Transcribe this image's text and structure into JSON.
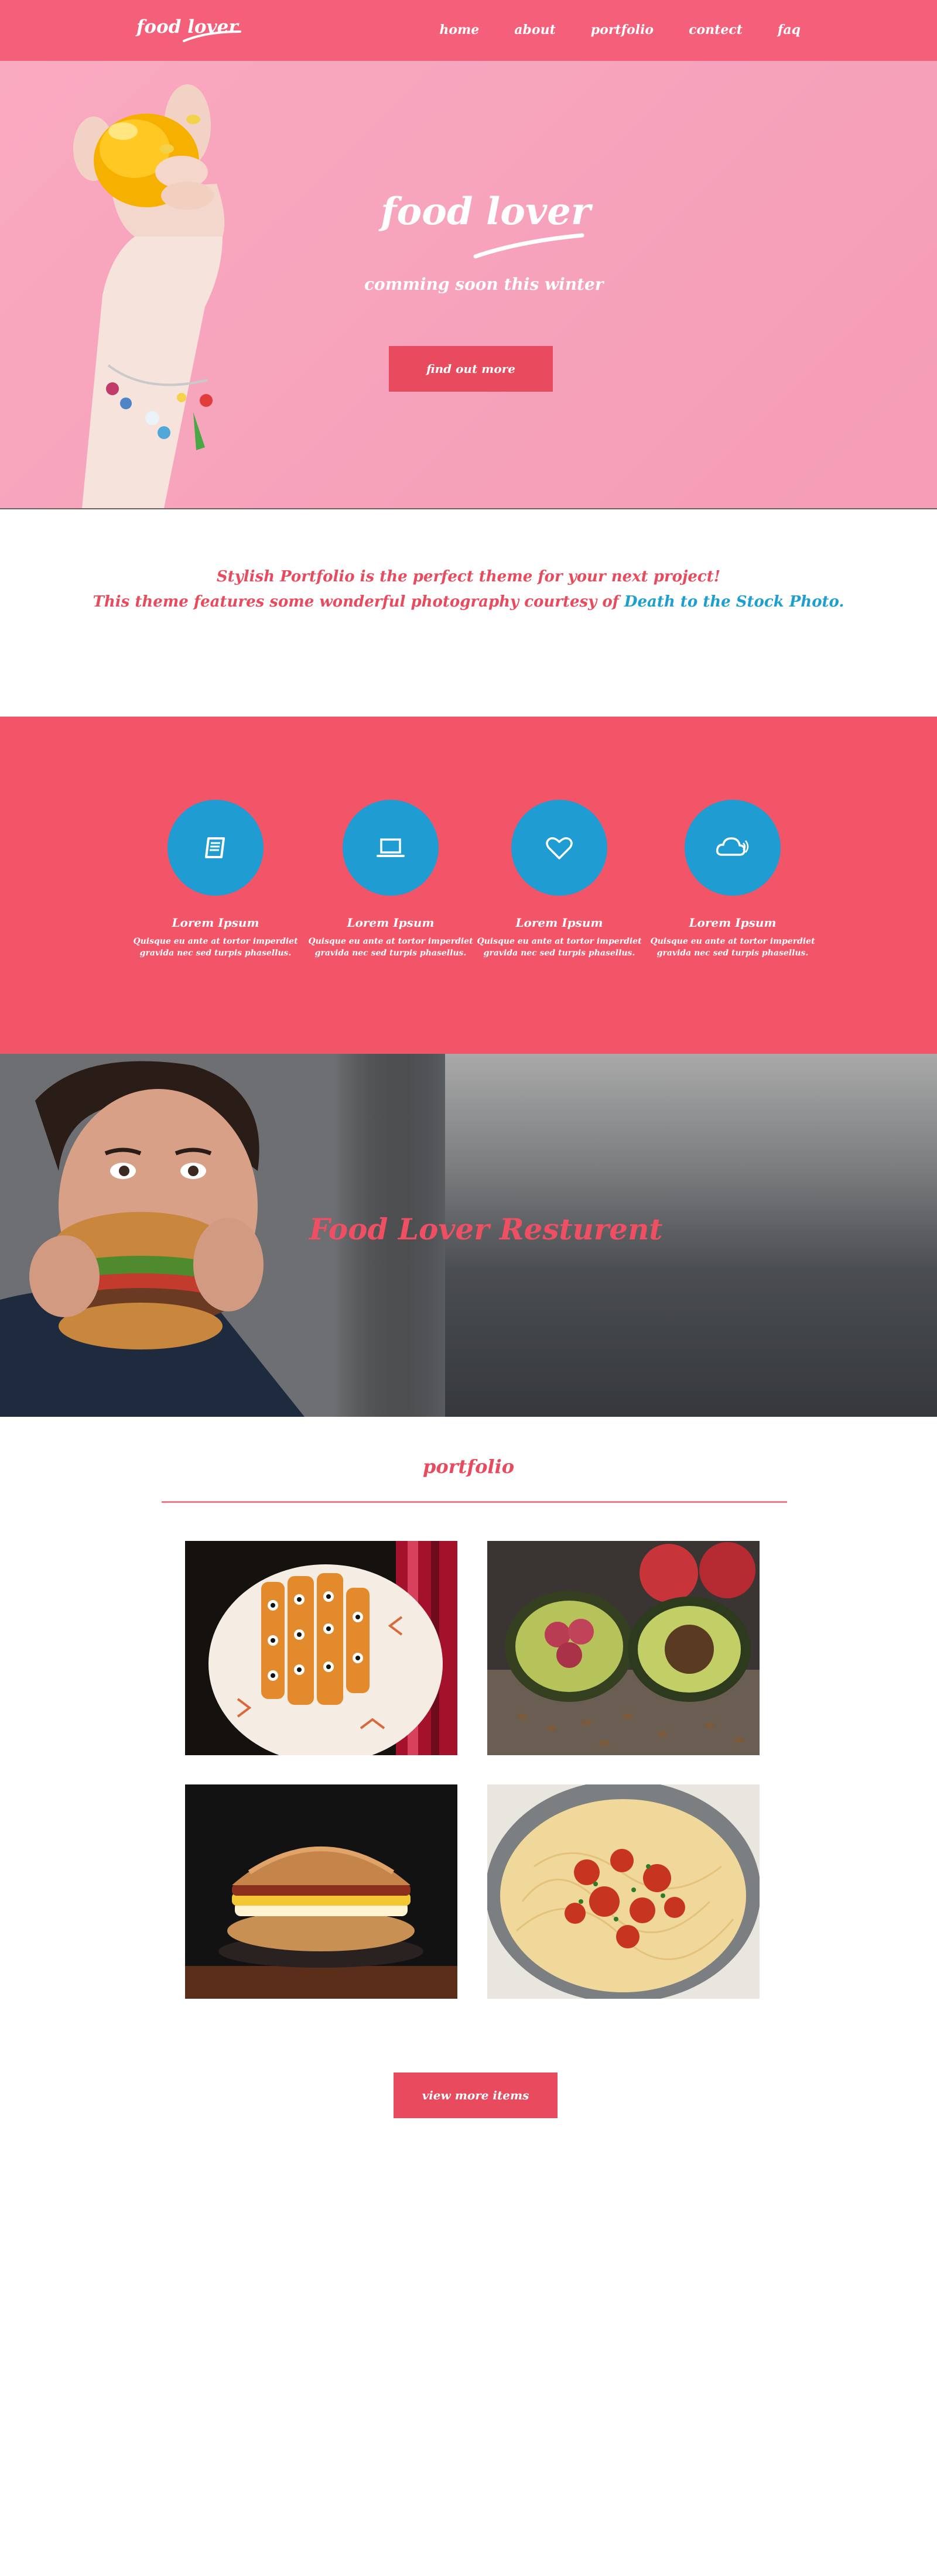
{
  "nav": {
    "logo": "food lover",
    "links": [
      "home",
      "about",
      "portfolio",
      "contect",
      "faq"
    ]
  },
  "hero": {
    "title": "food lover",
    "subtitle": "comming soon this winter",
    "button": "find out more"
  },
  "intro": {
    "line1": "Stylish Portfolio is the perfect theme for your next project!",
    "line2_prefix": "This theme features some wonderful photography courtesy of ",
    "line2_link": "Death to the Stock Photo."
  },
  "services": [
    {
      "icon": "book-icon",
      "title": "Lorem Ipsum",
      "text_line1": "Quisque eu ante at tortor imperdiet",
      "text_line2": "gravida nec sed turpis phasellus."
    },
    {
      "icon": "laptop-icon",
      "title": "Lorem Ipsum",
      "text_line1": "Quisque eu ante at tortor imperdiet",
      "text_line2": "gravida nec sed turpis phasellus."
    },
    {
      "icon": "heart-icon",
      "title": "Lorem Ipsum",
      "text_line1": "Quisque eu ante at tortor imperdiet",
      "text_line2": "gravida nec sed turpis phasellus."
    },
    {
      "icon": "cloud-icon",
      "title": "Lorem Ipsum",
      "text_line1": "Quisque eu ante at tortor imperdiet",
      "text_line2": "gravida nec sed turpis phasellus."
    }
  ],
  "banner": {
    "title": "Food Lover Resturent"
  },
  "portfolio": {
    "heading": "portfolio",
    "items": [
      "tacos-photo",
      "avocado-raspberry-photo",
      "breakfast-sandwich-photo",
      "spaghetti-photo"
    ],
    "button": "view more items"
  },
  "colors": {
    "nav": "#f45f7a",
    "accent": "#e84b5e",
    "services_bg": "#f25468",
    "icon_circle": "#1f9dd3",
    "link": "#1e9fd0"
  }
}
